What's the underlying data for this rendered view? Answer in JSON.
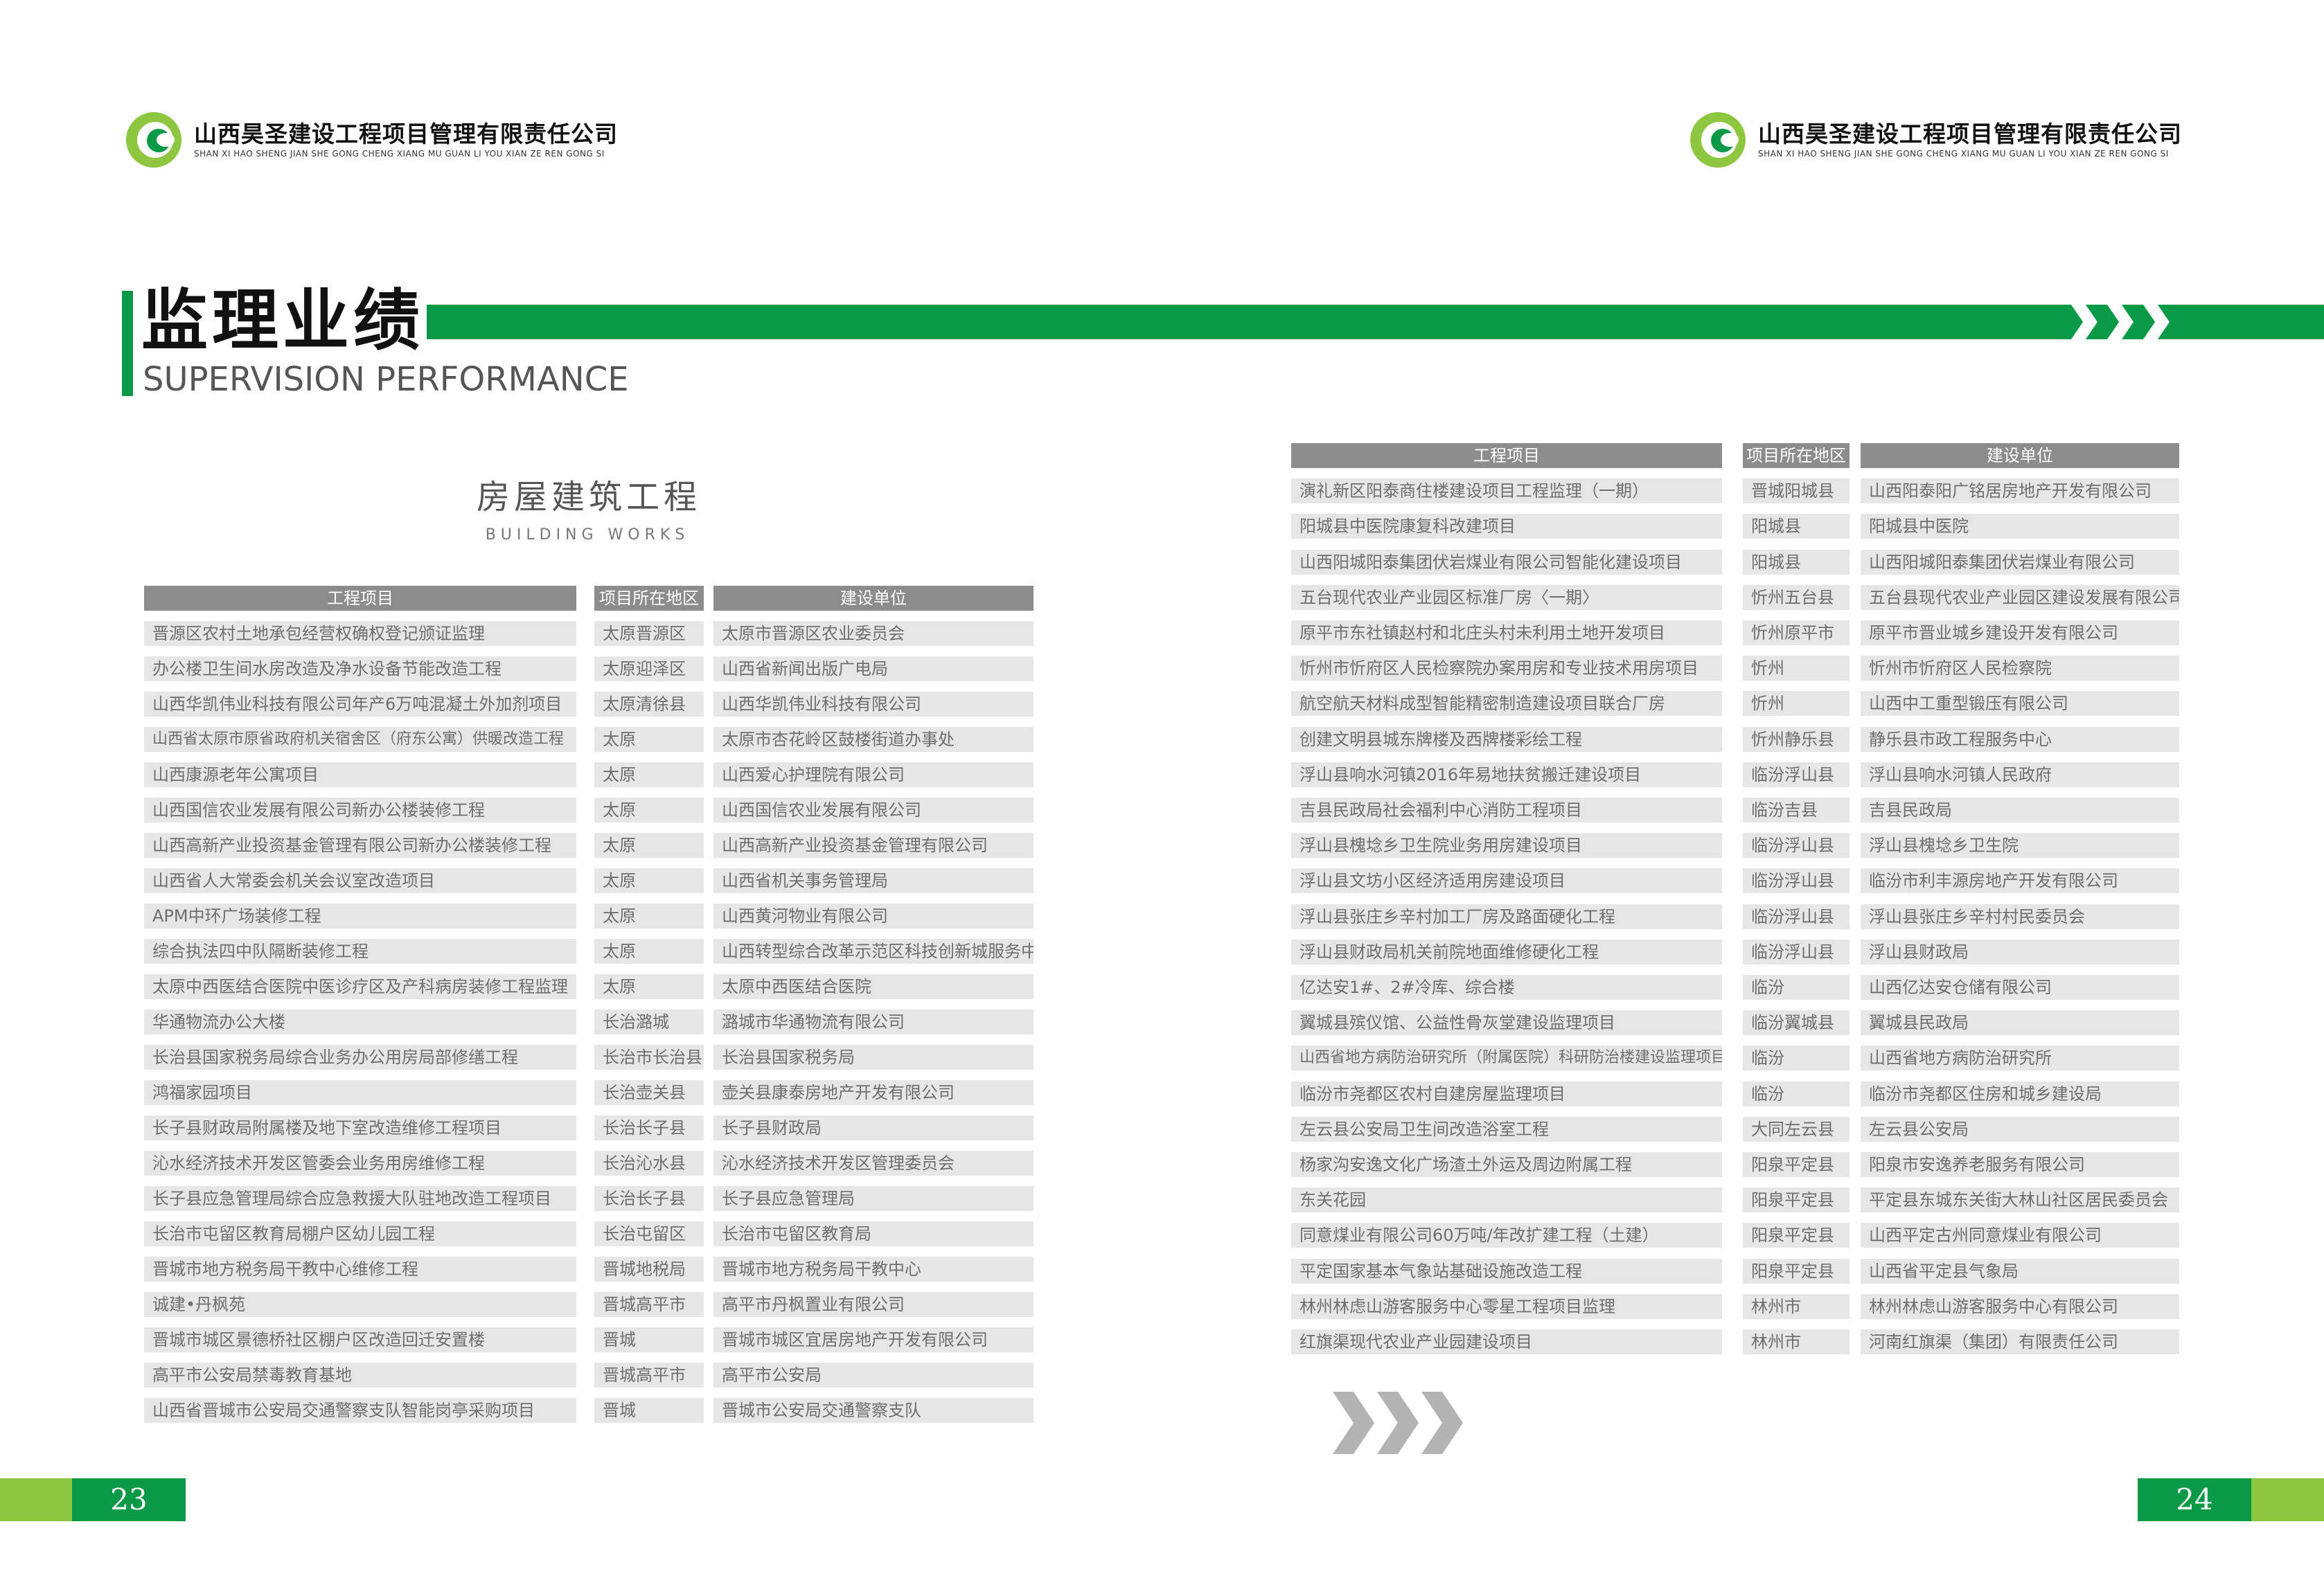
{
  "company": {
    "name_cn": "山西昊圣建设工程项目管理有限责任公司",
    "name_en": "SHAN XI HAO SHENG JIAN SHE GONG CHENG XIANG MU GUAN LI YOU XIAN ZE REN GONG SI"
  },
  "title": {
    "cn": "监理业绩",
    "en": "SUPERVISION PERFORMANCE"
  },
  "section": {
    "cn": "房屋建筑工程",
    "en": "BUILDING WORKS"
  },
  "table_headers": {
    "project": "工程项目",
    "region": "项目所在地区",
    "unit": "建设单位"
  },
  "left_table": [
    [
      "晋源区农村土地承包经营权确权登记颁证监理",
      "太原晋源区",
      "太原市晋源区农业委员会"
    ],
    [
      "办公楼卫生间水房改造及净水设备节能改造工程",
      "太原迎泽区",
      "山西省新闻出版广电局"
    ],
    [
      "山西华凯伟业科技有限公司年产6万吨混凝土外加剂项目",
      "太原清徐县",
      "山西华凯伟业科技有限公司"
    ],
    [
      "山西省太原市原省政府机关宿舍区（府东公寓）供暖改造工程",
      "太原",
      "太原市杏花岭区鼓楼街道办事处"
    ],
    [
      "山西康源老年公寓项目",
      "太原",
      "山西爱心护理院有限公司"
    ],
    [
      "山西国信农业发展有限公司新办公楼装修工程",
      "太原",
      "山西国信农业发展有限公司"
    ],
    [
      "山西高新产业投资基金管理有限公司新办公楼装修工程",
      "太原",
      "山西高新产业投资基金管理有限公司"
    ],
    [
      "山西省人大常委会机关会议室改造项目",
      "太原",
      "山西省机关事务管理局"
    ],
    [
      "APM中环广场装修工程",
      "太原",
      "山西黄河物业有限公司"
    ],
    [
      "综合执法四中队隔断装修工程",
      "太原",
      "山西转型综合改革示范区科技创新城服务中心"
    ],
    [
      "太原中西医结合医院中医诊疗区及产科病房装修工程监理",
      "太原",
      "太原中西医结合医院"
    ],
    [
      "华通物流办公大楼",
      "长治潞城",
      "潞城市华通物流有限公司"
    ],
    [
      "长治县国家税务局综合业务办公用房局部修缮工程",
      "长治市长治县",
      "长治县国家税务局"
    ],
    [
      "鸿福家园项目",
      "长治壶关县",
      "壶关县康泰房地产开发有限公司"
    ],
    [
      "长子县财政局附属楼及地下室改造维修工程项目",
      "长治长子县",
      "长子县财政局"
    ],
    [
      "沁水经济技术开发区管委会业务用房维修工程",
      "长治沁水县",
      "沁水经济技术开发区管理委员会"
    ],
    [
      "长子县应急管理局综合应急救援大队驻地改造工程项目",
      "长治长子县",
      "长子县应急管理局"
    ],
    [
      "长治市屯留区教育局棚户区幼儿园工程",
      "长治屯留区",
      "长治市屯留区教育局"
    ],
    [
      "晋城市地方税务局干教中心维修工程",
      "晋城地税局",
      "晋城市地方税务局干教中心"
    ],
    [
      "诚建•丹枫苑",
      "晋城高平市",
      "高平市丹枫置业有限公司"
    ],
    [
      "晋城市城区景德桥社区棚户区改造回迁安置楼",
      "晋城",
      "晋城市城区宜居房地产开发有限公司"
    ],
    [
      "高平市公安局禁毒教育基地",
      "晋城高平市",
      "高平市公安局"
    ],
    [
      "山西省晋城市公安局交通警察支队智能岗亭采购项目",
      "晋城",
      "晋城市公安局交通警察支队"
    ]
  ],
  "right_table": [
    [
      "演礼新区阳泰商住楼建设项目工程监理（一期）",
      "晋城阳城县",
      "山西阳泰阳广铭居房地产开发有限公司"
    ],
    [
      "阳城县中医院康复科改建项目",
      "阳城县",
      "阳城县中医院"
    ],
    [
      "山西阳城阳泰集团伏岩煤业有限公司智能化建设项目",
      "阳城县",
      "山西阳城阳泰集团伏岩煤业有限公司"
    ],
    [
      "五台现代农业产业园区标准厂房〈一期〉",
      "忻州五台县",
      "五台县现代农业产业园区建设发展有限公司"
    ],
    [
      "原平市东社镇赵村和北庄头村未利用土地开发项目",
      "忻州原平市",
      "原平市晋业城乡建设开发有限公司"
    ],
    [
      "忻州市忻府区人民检察院办案用房和专业技术用房项目",
      "忻州",
      "忻州市忻府区人民检察院"
    ],
    [
      "航空航天材料成型智能精密制造建设项目联合厂房",
      "忻州",
      "山西中工重型锻压有限公司"
    ],
    [
      "创建文明县城东牌楼及西牌楼彩绘工程",
      "忻州静乐县",
      "静乐县市政工程服务中心"
    ],
    [
      "浮山县响水河镇2016年易地扶贫搬迁建设项目",
      "临汾浮山县",
      "浮山县响水河镇人民政府"
    ],
    [
      "吉县民政局社会福利中心消防工程项目",
      "临汾吉县",
      "吉县民政局"
    ],
    [
      "浮山县槐埝乡卫生院业务用房建设项目",
      "临汾浮山县",
      "浮山县槐埝乡卫生院"
    ],
    [
      "浮山县文坊小区经济适用房建设项目",
      "临汾浮山县",
      "临汾市利丰源房地产开发有限公司"
    ],
    [
      "浮山县张庄乡辛村加工厂房及路面硬化工程",
      "临汾浮山县",
      "浮山县张庄乡辛村村民委员会"
    ],
    [
      "浮山县财政局机关前院地面维修硬化工程",
      "临汾浮山县",
      "浮山县财政局"
    ],
    [
      "亿达安1#、2#冷库、综合楼",
      "临汾",
      "山西亿达安仓储有限公司"
    ],
    [
      "翼城县殡仪馆、公益性骨灰堂建设监理项目",
      "临汾翼城县",
      "翼城县民政局"
    ],
    [
      "山西省地方病防治研究所（附属医院）科研防治楼建设监理项目",
      "临汾",
      "山西省地方病防治研究所"
    ],
    [
      "临汾市尧都区农村自建房屋监理项目",
      "临汾",
      "临汾市尧都区住房和城乡建设局"
    ],
    [
      "左云县公安局卫生间改造浴室工程",
      "大同左云县",
      "左云县公安局"
    ],
    [
      "杨家沟安逸文化广场渣土外运及周边附属工程",
      "阳泉平定县",
      "阳泉市安逸养老服务有限公司"
    ],
    [
      "东关花园",
      "阳泉平定县",
      "平定县东城东关街大林山社区居民委员会"
    ],
    [
      "同意煤业有限公司60万吨/年改扩建工程（土建）",
      "阳泉平定县",
      "山西平定古州同意煤业有限公司"
    ],
    [
      "平定国家基本气象站基础设施改造工程",
      "阳泉平定县",
      "山西省平定县气象局"
    ],
    [
      "林州林虑山游客服务中心零星工程项目监理",
      "林州市",
      "林州林虑山游客服务中心有限公司"
    ],
    [
      "红旗渠现代农业产业园建设项目",
      "林州市",
      "河南红旗渠（集团）有限责任公司"
    ]
  ],
  "page_numbers": {
    "left": "23",
    "right": "24"
  },
  "colors": {
    "brand_green": "#0a9a47",
    "light_green": "#8dc63f",
    "header_gray": "#8c8c8c",
    "row_gray": "#e6e6e6"
  }
}
